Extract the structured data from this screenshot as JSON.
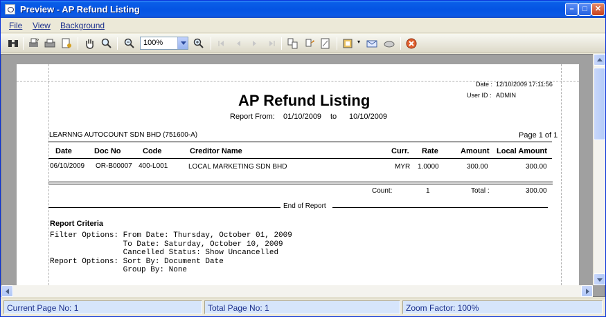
{
  "window": {
    "title": "Preview - AP Refund Listing"
  },
  "menu": {
    "items": [
      "File",
      "View",
      "Background"
    ]
  },
  "toolbar": {
    "zoom": "100%"
  },
  "report": {
    "date_label": "Date :",
    "date_value": "12/10/2009 17:11:56",
    "user_label": "User ID :",
    "user_value": "ADMIN",
    "title": "AP Refund Listing",
    "from_label": "Report From:",
    "from_date": "01/10/2009",
    "to_label": "to",
    "to_date": "10/10/2009",
    "company": "LEARNNG AUTOCOUNT SDN BHD (751600-A)",
    "page_label": "Page 1 of 1",
    "columns": [
      "Date",
      "Doc No",
      "Code",
      "Creditor Name",
      "Curr.",
      "Rate",
      "Amount",
      "Local Amount"
    ],
    "rows": [
      [
        "06/10/2009",
        "OR-B00007",
        "400-L001",
        "LOCAL MARKETING SDN BHD",
        "MYR",
        "1.0000",
        "300.00",
        "300.00"
      ]
    ],
    "count_label": "Count:",
    "count_value": "1",
    "total_label": "Total :",
    "total_value": "300.00",
    "end_label": "End of Report",
    "criteria_title": "Report Criteria",
    "criteria_lines": [
      "Filter Options: From Date: Thursday, October 01, 2009",
      "                To Date: Saturday, October 10, 2009",
      "                Cancelled Status: Show Uncancelled",
      "Report Options: Sort By: Document Date",
      "                Group By: None"
    ]
  },
  "status": {
    "current_page": "Current Page No: 1",
    "total_page": "Total Page No: 1",
    "zoom_factor": "Zoom Factor: 100%"
  }
}
